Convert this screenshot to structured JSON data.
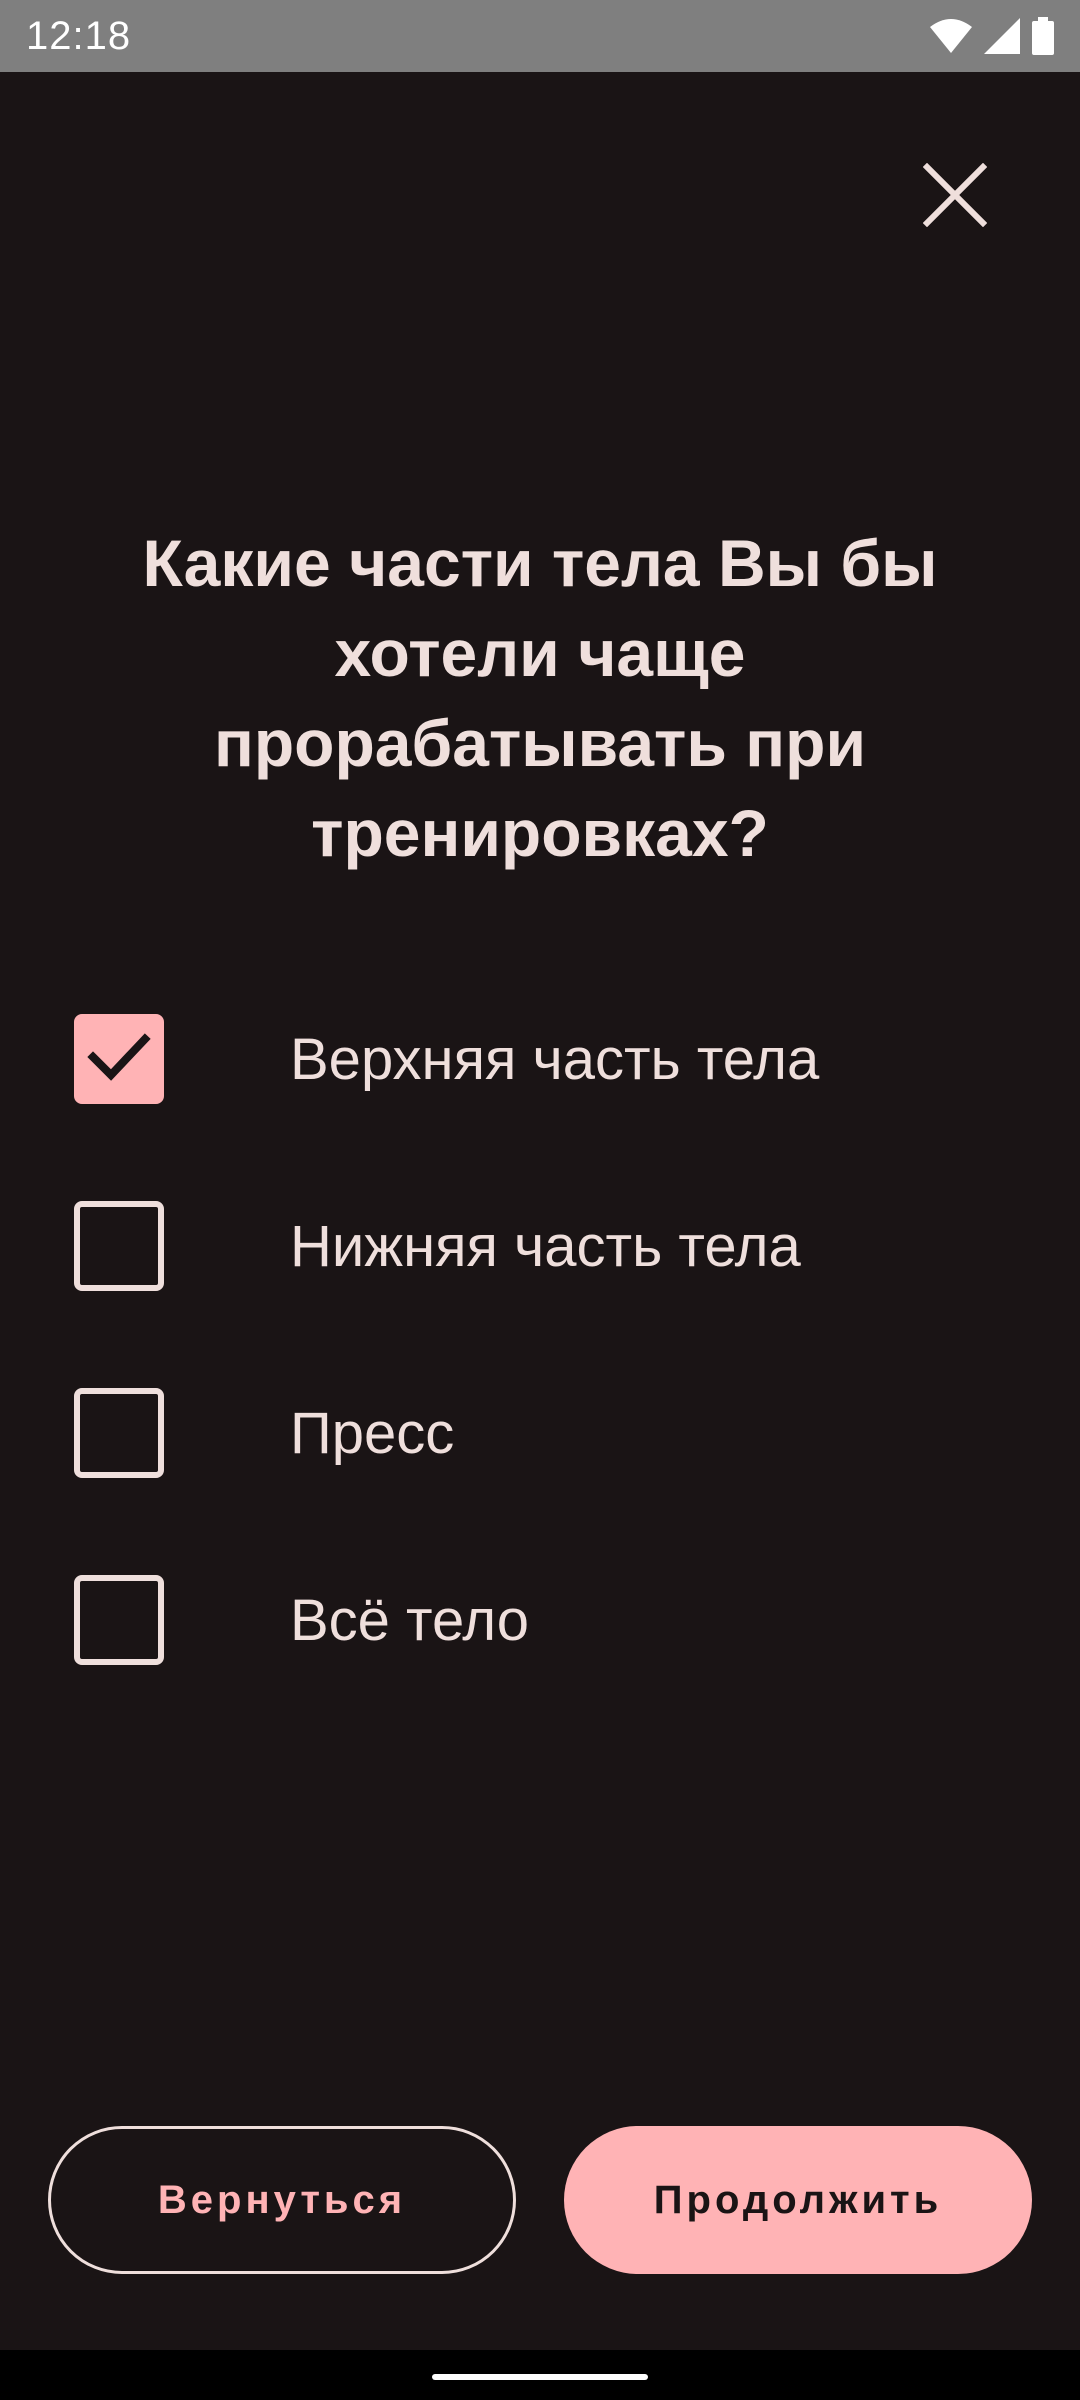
{
  "status_bar": {
    "time": "12:18",
    "icons": [
      "wifi-icon",
      "cellular-signal-icon",
      "battery-icon"
    ]
  },
  "close": {
    "icon": "close-icon"
  },
  "question": {
    "title": "Какие части тела Вы бы хотели чаще прорабатывать при тренировках?"
  },
  "options": [
    {
      "label": "Верхняя часть тела",
      "checked": true
    },
    {
      "label": "Нижняя часть тела",
      "checked": false
    },
    {
      "label": "Пресс",
      "checked": false
    },
    {
      "label": "Всё тело",
      "checked": false
    }
  ],
  "buttons": {
    "back_label": "Вернуться",
    "continue_label": "Продолжить"
  },
  "colors": {
    "background": "#1a1415",
    "accent": "#ffb3b5",
    "text": "#efdfdc"
  }
}
